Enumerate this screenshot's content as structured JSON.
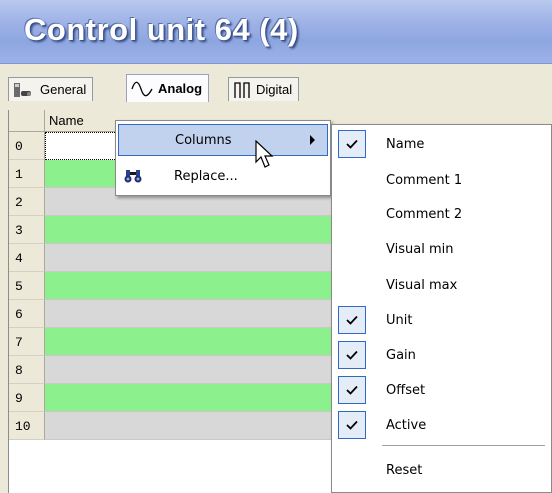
{
  "window": {
    "title": "Control unit 64 (4)"
  },
  "tabs": [
    {
      "label": "General",
      "icon": "general-icon",
      "active": false
    },
    {
      "label": "Analog",
      "icon": "sine-wave-icon",
      "active": true
    },
    {
      "label": "Digital",
      "icon": "pulse-wave-icon",
      "active": false
    }
  ],
  "grid": {
    "column_name": "Name",
    "rows": [
      "0",
      "1",
      "2",
      "3",
      "4",
      "5",
      "6",
      "7",
      "8",
      "9",
      "10"
    ]
  },
  "context_menu": {
    "items": [
      {
        "label": "Columns",
        "has_submenu": true,
        "selected": true
      },
      {
        "label": "Replace...",
        "icon": "binoculars-icon"
      }
    ]
  },
  "columns_submenu": {
    "items": [
      {
        "label": "Name",
        "checked": true
      },
      {
        "label": "Comment 1",
        "checked": false
      },
      {
        "label": "Comment 2",
        "checked": false
      },
      {
        "label": "Visual min",
        "checked": false
      },
      {
        "label": "Visual max",
        "checked": false
      },
      {
        "label": "Unit",
        "checked": true
      },
      {
        "label": "Gain",
        "checked": true
      },
      {
        "label": "Offset",
        "checked": true
      },
      {
        "label": "Active",
        "checked": true
      }
    ],
    "reset_label": "Reset"
  },
  "colors": {
    "row_green": "#8cf08c",
    "row_gray": "#d8d8d8",
    "selection": "#c1d2ee",
    "title_gradient": "#9fb3e6"
  }
}
